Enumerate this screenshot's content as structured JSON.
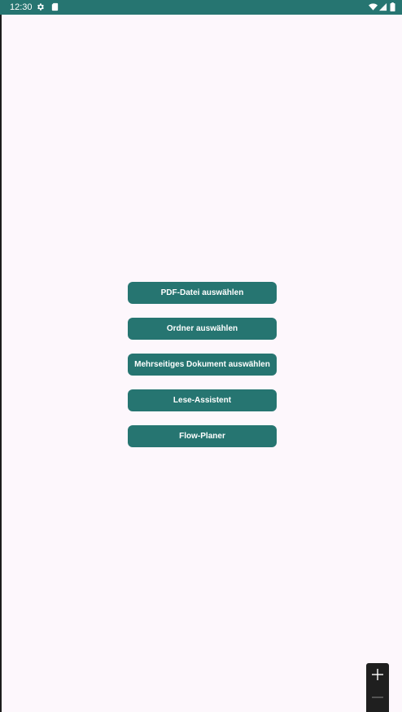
{
  "status_bar": {
    "time": "12:30",
    "background": "#267571",
    "left_icons": [
      "gear-icon",
      "sd-card-icon"
    ],
    "right_icons": [
      "wifi-icon",
      "signal-icon",
      "battery-icon"
    ]
  },
  "main": {
    "background": "#fdf7fc",
    "button_color": "#267571",
    "buttons": [
      {
        "label": "PDF-Datei auswählen"
      },
      {
        "label": "Ordner auswählen"
      },
      {
        "label": "Mehrseitiges Dokument auswählen"
      },
      {
        "label": "Lese-Assistent"
      },
      {
        "label": "Flow-Planer"
      }
    ]
  },
  "zoom_controls": {
    "icons": [
      "zoom-in-icon",
      "zoom-out-icon"
    ]
  }
}
